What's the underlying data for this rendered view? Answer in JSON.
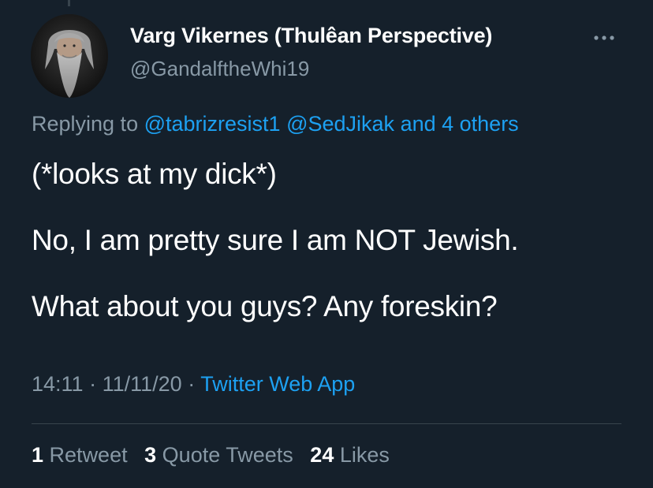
{
  "tweet": {
    "author": {
      "display_name": "Varg Vikernes (Thulêan Perspective)",
      "handle": "@GandalftheWhi19",
      "avatar_icon": "bearded-man-avatar"
    },
    "more_icon": "more-horizontal-icon",
    "replying": {
      "prefix": "Replying to",
      "mention_1": "@tabrizresist1",
      "mention_2": "@SedJikak",
      "others": "and 4 others"
    },
    "text_lines": [
      "(*looks at my dick*)",
      "No, I am pretty sure I am NOT Jewish.",
      "What about you guys? Any foreskin?"
    ],
    "meta": {
      "time": "14:11",
      "separator": "·",
      "date": "11/11/20",
      "source": "Twitter Web App"
    },
    "stats": {
      "retweets_count": "1",
      "retweets_label": "Retweet",
      "quotes_count": "3",
      "quotes_label": "Quote Tweets",
      "likes_count": "24",
      "likes_label": "Likes"
    }
  },
  "colors": {
    "background": "#15202b",
    "primary_text": "#ffffff",
    "secondary_text": "#8899a6",
    "link": "#1da1f2",
    "divider": "#38444d"
  }
}
